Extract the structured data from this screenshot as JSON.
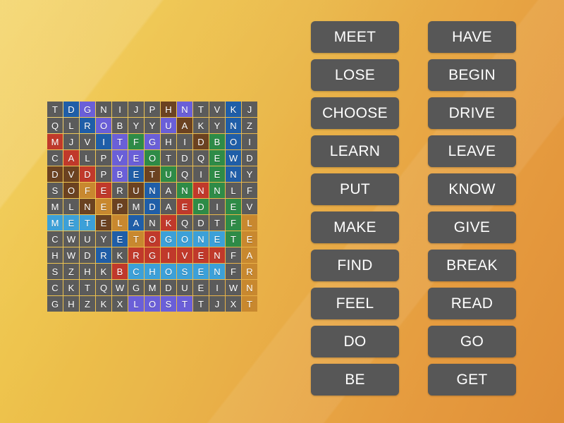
{
  "background": {
    "color_start": "#f2cf56",
    "color_end": "#e08f38"
  },
  "grid": {
    "rows": 13,
    "cols": 13,
    "default_cell_color": "#5b5b5b",
    "letters": [
      [
        "T",
        "D",
        "G",
        "N",
        "I",
        "J",
        "P",
        "H",
        "N",
        "T",
        "V",
        "K",
        "J"
      ],
      [
        "Q",
        "L",
        "R",
        "O",
        "B",
        "Y",
        "Y",
        "U",
        "A",
        "K",
        "Y",
        "N",
        "Z"
      ],
      [
        "M",
        "J",
        "V",
        "I",
        "T",
        "F",
        "G",
        "H",
        "I",
        "D",
        "B",
        "O",
        "I"
      ],
      [
        "C",
        "A",
        "L",
        "P",
        "V",
        "E",
        "O",
        "T",
        "D",
        "Q",
        "E",
        "W",
        "D"
      ],
      [
        "D",
        "V",
        "D",
        "P",
        "B",
        "E",
        "T",
        "U",
        "Q",
        "I",
        "E",
        "N",
        "Y"
      ],
      [
        "S",
        "O",
        "F",
        "E",
        "R",
        "U",
        "N",
        "A",
        "N",
        "N",
        "N",
        "L",
        "F"
      ],
      [
        "M",
        "L",
        "N",
        "E",
        "P",
        "M",
        "D",
        "A",
        "E",
        "D",
        "I",
        "E",
        "V"
      ],
      [
        "M",
        "E",
        "T",
        "E",
        "L",
        "A",
        "N",
        "K",
        "Q",
        "D",
        "T",
        "F",
        "L"
      ],
      [
        "C",
        "W",
        "U",
        "Y",
        "E",
        "T",
        "O",
        "G",
        "O",
        "N",
        "E",
        "T",
        "E"
      ],
      [
        "H",
        "W",
        "D",
        "R",
        "K",
        "R",
        "G",
        "I",
        "V",
        "E",
        "N",
        "F",
        "A"
      ],
      [
        "S",
        "Z",
        "H",
        "K",
        "B",
        "C",
        "H",
        "O",
        "S",
        "E",
        "N",
        "F",
        "R"
      ],
      [
        "C",
        "K",
        "T",
        "Q",
        "W",
        "G",
        "M",
        "D",
        "U",
        "E",
        "I",
        "W",
        "N"
      ],
      [
        "G",
        "H",
        "Z",
        "K",
        "X",
        "L",
        "O",
        "S",
        "T",
        "T",
        "J",
        "X",
        "T"
      ]
    ],
    "colors": [
      [
        "#5b5b5b",
        "#1f5ea8",
        "#6a5fd8",
        "#5b5b5b",
        "#5b5b5b",
        "#5b5b5b",
        "#5b5b5b",
        "#6b4221",
        "#6a5fd8",
        "#5b5b5b",
        "#5b5b5b",
        "#1f5ea8",
        "#5b5b5b"
      ],
      [
        "#5b5b5b",
        "#5b5b5b",
        "#1f5ea8",
        "#6a5fd8",
        "#5b5b5b",
        "#5b5b5b",
        "#5b5b5b",
        "#6a5fd8",
        "#6b4221",
        "#5b5b5b",
        "#5b5b5b",
        "#1f5ea8",
        "#5b5b5b"
      ],
      [
        "#c0392b",
        "#5b5b5b",
        "#5b5b5b",
        "#1f5ea8",
        "#6a5fd8",
        "#2e8b47",
        "#6a5fd8",
        "#5b5b5b",
        "#5b5b5b",
        "#6b4221",
        "#2e8b47",
        "#1f5ea8",
        "#5b5b5b"
      ],
      [
        "#5b5b5b",
        "#c0392b",
        "#5b5b5b",
        "#5b5b5b",
        "#6a5fd8",
        "#6a5fd8",
        "#2e8b47",
        "#5b5b5b",
        "#5b5b5b",
        "#5b5b5b",
        "#2e8b47",
        "#1f5ea8",
        "#5b5b5b"
      ],
      [
        "#6b4221",
        "#6b4221",
        "#c0392b",
        "#5b5b5b",
        "#6a5fd8",
        "#1f5ea8",
        "#6b4221",
        "#2e8b47",
        "#5b5b5b",
        "#5b5b5b",
        "#2e8b47",
        "#1f5ea8",
        "#5b5b5b"
      ],
      [
        "#5b5b5b",
        "#6b4221",
        "#c8882f",
        "#c0392b",
        "#5b5b5b",
        "#6b4221",
        "#1f5ea8",
        "#5b5b5b",
        "#2e8b47",
        "#c0392b",
        "#2e8b47",
        "#5b5b5b",
        "#5b5b5b"
      ],
      [
        "#5b5b5b",
        "#5b5b5b",
        "#6b4221",
        "#c8882f",
        "#6b4221",
        "#5b5b5b",
        "#1f5ea8",
        "#5b5b5b",
        "#c0392b",
        "#2e8b47",
        "#5b5b5b",
        "#2e8b47",
        "#5b5b5b"
      ],
      [
        "#3ca0d8",
        "#3ca0d8",
        "#3ca0d8",
        "#6b4221",
        "#c8882f",
        "#1f5ea8",
        "#5b5b5b",
        "#c0392b",
        "#5b5b5b",
        "#5b5b5b",
        "#5b5b5b",
        "#2e8b47",
        "#c8882f"
      ],
      [
        "#5b5b5b",
        "#5b5b5b",
        "#5b5b5b",
        "#5b5b5b",
        "#1f5ea8",
        "#c8882f",
        "#c0392b",
        "#3ca0d8",
        "#3ca0d8",
        "#3ca0d8",
        "#3ca0d8",
        "#2e8b47",
        "#c8882f"
      ],
      [
        "#5b5b5b",
        "#5b5b5b",
        "#5b5b5b",
        "#1f5ea8",
        "#5b5b5b",
        "#c0392b",
        "#c0392b",
        "#c0392b",
        "#c0392b",
        "#c0392b",
        "#c0392b",
        "#5b5b5b",
        "#c8882f"
      ],
      [
        "#5b5b5b",
        "#5b5b5b",
        "#5b5b5b",
        "#5b5b5b",
        "#c0392b",
        "#3ca0d8",
        "#3ca0d8",
        "#3ca0d8",
        "#3ca0d8",
        "#3ca0d8",
        "#3ca0d8",
        "#5b5b5b",
        "#c8882f"
      ],
      [
        "#5b5b5b",
        "#5b5b5b",
        "#5b5b5b",
        "#5b5b5b",
        "#5b5b5b",
        "#5b5b5b",
        "#5b5b5b",
        "#5b5b5b",
        "#5b5b5b",
        "#5b5b5b",
        "#5b5b5b",
        "#5b5b5b",
        "#c8882f"
      ],
      [
        "#5b5b5b",
        "#5b5b5b",
        "#5b5b5b",
        "#5b5b5b",
        "#5b5b5b",
        "#6a5fd8",
        "#6a5fd8",
        "#6a5fd8",
        "#6a5fd8",
        "#5b5b5b",
        "#5b5b5b",
        "#5b5b5b",
        "#c8882f"
      ]
    ]
  },
  "word_list": {
    "left_column": [
      {
        "label": "MEET"
      },
      {
        "label": "LOSE"
      },
      {
        "label": "CHOOSE"
      },
      {
        "label": "LEARN"
      },
      {
        "label": "PUT"
      },
      {
        "label": "MAKE"
      },
      {
        "label": "FIND"
      },
      {
        "label": "FEEL"
      },
      {
        "label": "DO"
      },
      {
        "label": "BE"
      }
    ],
    "right_column": [
      {
        "label": "HAVE"
      },
      {
        "label": "BEGIN"
      },
      {
        "label": "DRIVE"
      },
      {
        "label": "LEAVE"
      },
      {
        "label": "KNOW"
      },
      {
        "label": "GIVE"
      },
      {
        "label": "BREAK"
      },
      {
        "label": "READ"
      },
      {
        "label": "GO"
      },
      {
        "label": "GET"
      }
    ],
    "button_color": "#575757",
    "button_text_color": "#ffffff"
  }
}
